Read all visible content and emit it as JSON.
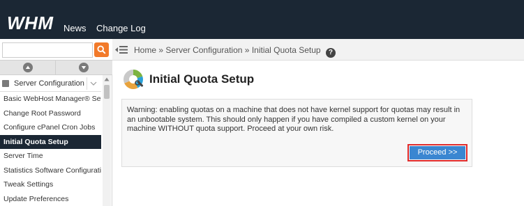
{
  "header": {
    "logo_text": "WHM",
    "nav": [
      {
        "label": "News"
      },
      {
        "label": "Change Log"
      }
    ]
  },
  "sidebar": {
    "search": {
      "value": "",
      "placeholder": ""
    },
    "category": "Server Configuration",
    "items": [
      {
        "label": "Basic WebHost Manager® Setup",
        "active": false
      },
      {
        "label": "Change Root Password",
        "active": false
      },
      {
        "label": "Configure cPanel Cron Jobs",
        "active": false
      },
      {
        "label": "Initial Quota Setup",
        "active": true
      },
      {
        "label": "Server Time",
        "active": false
      },
      {
        "label": "Statistics Software Configuration",
        "active": false
      },
      {
        "label": "Tweak Settings",
        "active": false
      },
      {
        "label": "Update Preferences",
        "active": false
      }
    ]
  },
  "breadcrumb": {
    "items": [
      "Home",
      "Server Configuration",
      "Initial Quota Setup"
    ],
    "separator": "»",
    "help_label": "?"
  },
  "main": {
    "title": "Initial Quota Setup",
    "warning": "Warning: enabling quotas on a machine that does not have kernel support for quotas may result in an unbootable system. This should only happen if you have compiled a custom kernel on your machine WITHOUT quota support. Proceed at your own risk.",
    "proceed_label": "Proceed >>"
  },
  "colors": {
    "topbar": "#1b2734",
    "search_button": "#f27a2a",
    "active_item": "#1b2734",
    "primary_button": "#3a86d1",
    "highlight_outline": "#e02b2b"
  },
  "icons": [
    "search-icon",
    "chevron-up-icon",
    "chevron-down-icon",
    "server-config-icon",
    "menu-toggle-icon",
    "help-icon",
    "quota-setup-icon"
  ]
}
